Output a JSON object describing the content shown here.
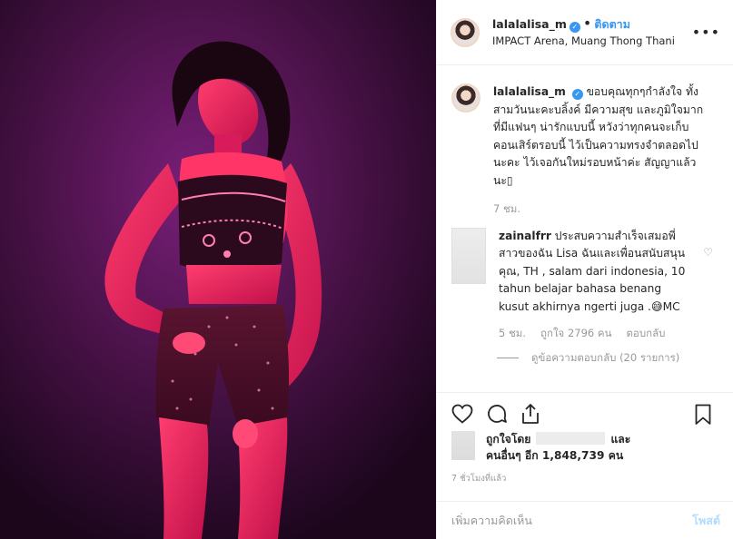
{
  "post": {
    "username": "lalalalisa_m",
    "follow_label": "ติดตาม",
    "location": "IMPACT Arena, Muang Thong Thani",
    "more_label": "•••",
    "verified_mark": "✓"
  },
  "caption": {
    "username": "lalalalisa_m",
    "text": "ขอบคุณทุกๆกำลังใจ ทั้งสามวันนะคะบลิ้งค์ มีความสุข และภูมิใจมากที่มีแฟนๆ น่ารักแบบนี้ หวังว่าทุกคนจะเก็บคอนเสิร์ตรอบนี้ ไว้เป็นความทรงจำตลอดไปนะคะ ไว้เจอกันใหม่รอบหน้าค่ะ สัญญาแล้วนะ▯",
    "time": "7 ชม."
  },
  "comment": {
    "username": "zainalfrr",
    "text": "ประสบความสำเร็จเสมอพี่สาวของฉัน Lisa ฉันและเพื่อนสนับสนุนคุณ, TH , salam dari indonesia, 10 tahun belajar bahasa benang kusut akhirnya ngerti juga .😅MC",
    "time": "5 ชม.",
    "likes": "ถูกใจ 2796 คน",
    "reply_label": "ตอบกลับ",
    "view_replies": "ดูข้อความตอบกลับ (20 รายการ)"
  },
  "likes": {
    "liked_by_prefix": "ถูกใจโดย",
    "and_label": "และ",
    "others": "คนอื่นๆ อีก 1,848,739 คน"
  },
  "time_ago": "7 ชั่วโมงที่แล้ว",
  "add_comment": {
    "placeholder": "เพิ่มความคิดเห็น",
    "post_label": "โพสต์"
  },
  "icons": [
    "heart-icon",
    "comment-icon",
    "share-icon",
    "bookmark-icon",
    "more-options-icon",
    "verified-badge-icon"
  ],
  "colors": {
    "accent": "#3897f0",
    "muted": "#999999",
    "post_disabled": "#b3dbff",
    "stage_light": "#e0107a"
  }
}
